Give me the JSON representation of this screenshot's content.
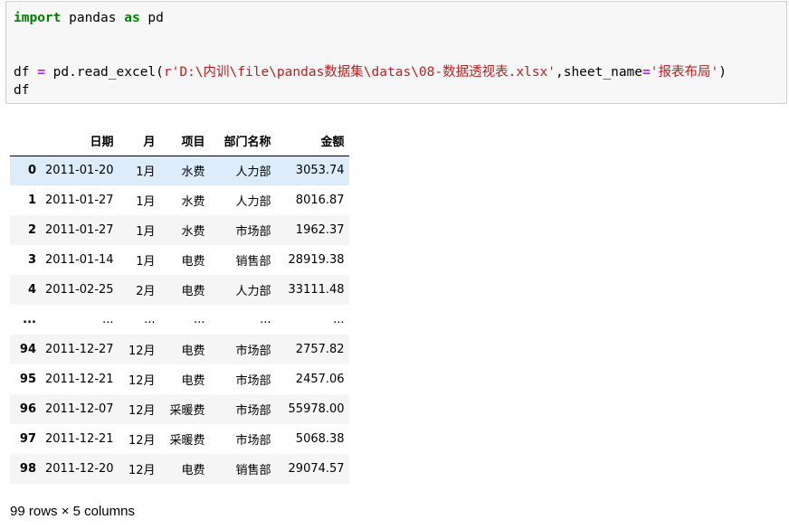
{
  "code": {
    "line1": {
      "kw_import": "import",
      "mid": " pandas ",
      "kw_as": "as",
      "end": " pd"
    },
    "line4": {
      "lhs": "df ",
      "eq": "=",
      "call_open": " pd.read_excel(",
      "path": "r'D:\\内训\\file\\pandas数据集\\datas\\08-数据透视表.xlsx'",
      "sep": ",sheet_name",
      "eq2": "=",
      "sheet": "'报表布局'",
      "close": ")"
    },
    "line5": "df"
  },
  "table": {
    "columns": [
      "",
      "日期",
      "月",
      "项目",
      "部门名称",
      "金额"
    ],
    "rows": [
      {
        "index": "0",
        "date": "2011-01-20",
        "month": "1月",
        "item": "水费",
        "dept": "人力部",
        "amount": "3053.74"
      },
      {
        "index": "1",
        "date": "2011-01-27",
        "month": "1月",
        "item": "水费",
        "dept": "人力部",
        "amount": "8016.87"
      },
      {
        "index": "2",
        "date": "2011-01-27",
        "month": "1月",
        "item": "水费",
        "dept": "市场部",
        "amount": "1962.37"
      },
      {
        "index": "3",
        "date": "2011-01-14",
        "month": "1月",
        "item": "电费",
        "dept": "销售部",
        "amount": "28919.38"
      },
      {
        "index": "4",
        "date": "2011-02-25",
        "month": "2月",
        "item": "电费",
        "dept": "人力部",
        "amount": "33111.48"
      },
      {
        "index": "...",
        "date": "...",
        "month": "...",
        "item": "...",
        "dept": "...",
        "amount": "..."
      },
      {
        "index": "94",
        "date": "2011-12-27",
        "month": "12月",
        "item": "电费",
        "dept": "市场部",
        "amount": "2757.82"
      },
      {
        "index": "95",
        "date": "2011-12-21",
        "month": "12月",
        "item": "电费",
        "dept": "市场部",
        "amount": "2457.06"
      },
      {
        "index": "96",
        "date": "2011-12-07",
        "month": "12月",
        "item": "采暖费",
        "dept": "市场部",
        "amount": "55978.00"
      },
      {
        "index": "97",
        "date": "2011-12-21",
        "month": "12月",
        "item": "采暖费",
        "dept": "市场部",
        "amount": "5068.38"
      },
      {
        "index": "98",
        "date": "2011-12-20",
        "month": "12月",
        "item": "电费",
        "dept": "销售部",
        "amount": "29074.57"
      }
    ]
  },
  "shape_text": "99 rows × 5 columns",
  "colors": {
    "keyword": "#008000",
    "operator": "#aa22ff",
    "string": "#ba2121",
    "row_highlight": "#dcecfa",
    "row_stripe": "#f5f5f5"
  }
}
